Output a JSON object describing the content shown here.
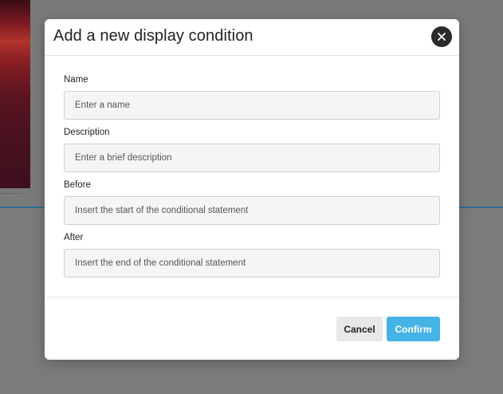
{
  "modal": {
    "title": "Add a new display condition",
    "fields": [
      {
        "label": "Name",
        "placeholder": "Enter a name"
      },
      {
        "label": "Description",
        "placeholder": "Enter a brief description"
      },
      {
        "label": "Before",
        "placeholder": "Insert the start of the conditional statement"
      },
      {
        "label": "After",
        "placeholder": "Insert the end of the conditional statement"
      }
    ],
    "cancel_label": "Cancel",
    "confirm_label": "Confirm",
    "close_icon": "close-icon"
  },
  "colors": {
    "accent": "#45b3e6",
    "overlay": "#7a7a7a",
    "close_button": "#2b2b2b"
  }
}
